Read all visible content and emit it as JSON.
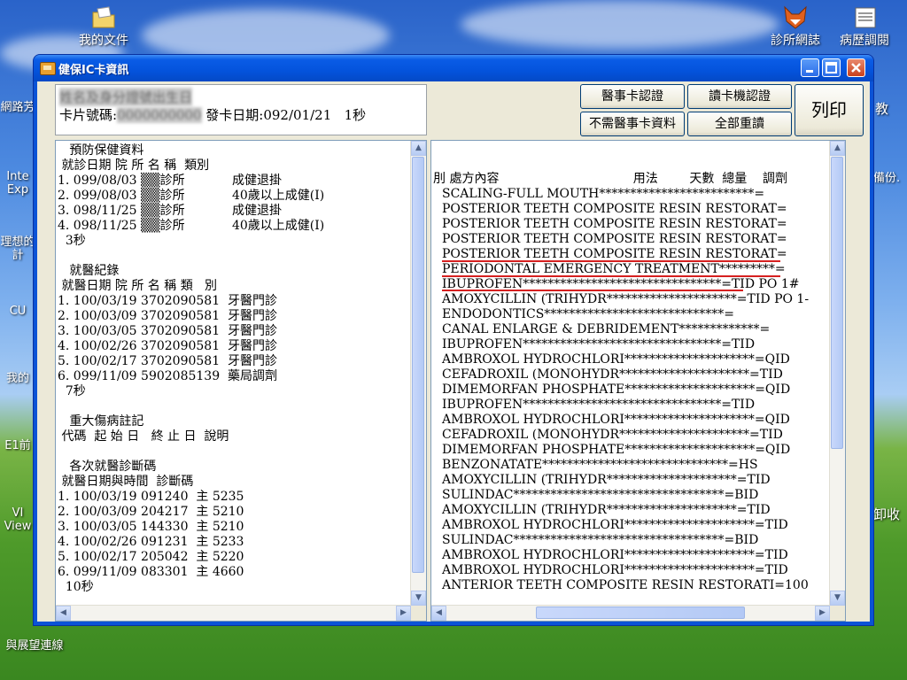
{
  "desktop": {
    "icons": [
      {
        "label": "我的文件"
      },
      {
        "label": "診所網誌"
      },
      {
        "label": "病歷調閱"
      }
    ],
    "left_labels": [
      "網路芳",
      "Inte Exp",
      "理想的計",
      "CU",
      "我的",
      "E1前",
      "VI View",
      "與展望連線"
    ],
    "right_labels": [
      "教",
      "備份.",
      "卸收"
    ]
  },
  "window": {
    "title": "健保IC卡資訊",
    "card": {
      "line1_blurred": "姓名及身分證號出生日",
      "card_no_label": "卡片號碼:",
      "card_no_blurred": "0000000000",
      "issue_label": "發卡日期:092/01/21",
      "timing": "1秒"
    },
    "buttons": {
      "doctor_card_auth": "醫事卡認證",
      "reader_auth": "讀卡機認證",
      "no_doctor_card": "不需醫事卡資料",
      "reset_all": "全部重讀",
      "print": "列印"
    },
    "left_panel": {
      "lines": [
        "   預防保健資料",
        " 就診日期 院 所 名 稱  類別",
        "1. 099/08/03 ▒▒診所            成健退掛",
        "2. 099/08/03 ▒▒診所            40歲以上成健(I)",
        "3. 098/11/25 ▒▒診所            成健退掛",
        "4. 098/11/25 ▒▒診所            40歲以上成健(I)",
        "  3秒",
        "",
        "   就醫紀錄",
        " 就醫日期 院 所 名 稱 類   別",
        "1. 100/03/19 3702090581  牙醫門診",
        "2. 100/03/09 3702090581  牙醫門診",
        "3. 100/03/05 3702090581  牙醫門診",
        "4. 100/02/26 3702090581  牙醫門診",
        "5. 100/02/17 3702090581  牙醫門診",
        "6. 099/11/09 5902085139  藥局調劑",
        "  7秒",
        "",
        "   重大傷病註記",
        " 代碼  起 始 日   終 止 日  說明",
        "",
        "   各次就醫診斷碼",
        " 就醫日期與時間  診斷碼",
        "1. 100/03/19 091240  主 5235",
        "2. 100/03/09 204217  主 5210",
        "3. 100/03/05 144330  主 5210",
        "4. 100/02/26 091231  主 5233",
        "5. 100/02/17 205042  主 5220",
        "6. 099/11/09 083301  主 4660",
        "  10秒"
      ]
    },
    "right_panel": {
      "header": "刖 處方內容                                  用法        天數  總量    調劑",
      "lines": [
        "SCALING-FULL MOUTH*************************=",
        "POSTERIOR TEETH COMPOSITE RESIN RESTORAT=",
        "POSTERIOR TEETH COMPOSITE RESIN RESTORAT=",
        "POSTERIOR TEETH COMPOSITE RESIN RESTORAT=",
        "POSTERIOR TEETH COMPOSITE RESIN RESTORAT=",
        "PERIODONTAL EMERGENCY TREATMENT*********=",
        "IBUPROFEN********************************=TID PO 1#",
        "AMOXYCILLIN (TRIHYDR*********************=TID PO 1-",
        "ENDODONTICS*****************************=",
        "CANAL ENLARGE & DEBRIDEMENT*************=",
        "IBUPROFEN********************************=TID",
        "AMBROXOL HYDROCHLORI*********************=QID",
        "CEFADROXIL (MONOHYDR*********************=TID",
        "DIMEMORFAN PHOSPHATE*********************=QID",
        "IBUPROFEN********************************=TID",
        "AMBROXOL HYDROCHLORI*********************=QID",
        "CEFADROXIL (MONOHYDR*********************=TID",
        "DIMEMORFAN PHOSPHATE*********************=QID",
        "BENZONATATE******************************=HS",
        "AMOXYCILLIN (TRIHYDR*********************=TID",
        "SULINDAC**********************************=BID",
        "AMOXYCILLIN (TRIHYDR*********************=TID",
        "AMBROXOL HYDROCHLORI*********************=TID",
        "SULINDAC**********************************=BID",
        "AMBROXOL HYDROCHLORI*********************=TID",
        "AMBROXOL HYDROCHLORI*********************=TID",
        "ANTERIOR TEETH COMPOSITE RESIN RESTORATI=100"
      ]
    }
  },
  "colors": {
    "title_bar": "#0453dc",
    "client_bg": "#ece9d8",
    "underline": "#d62020"
  }
}
